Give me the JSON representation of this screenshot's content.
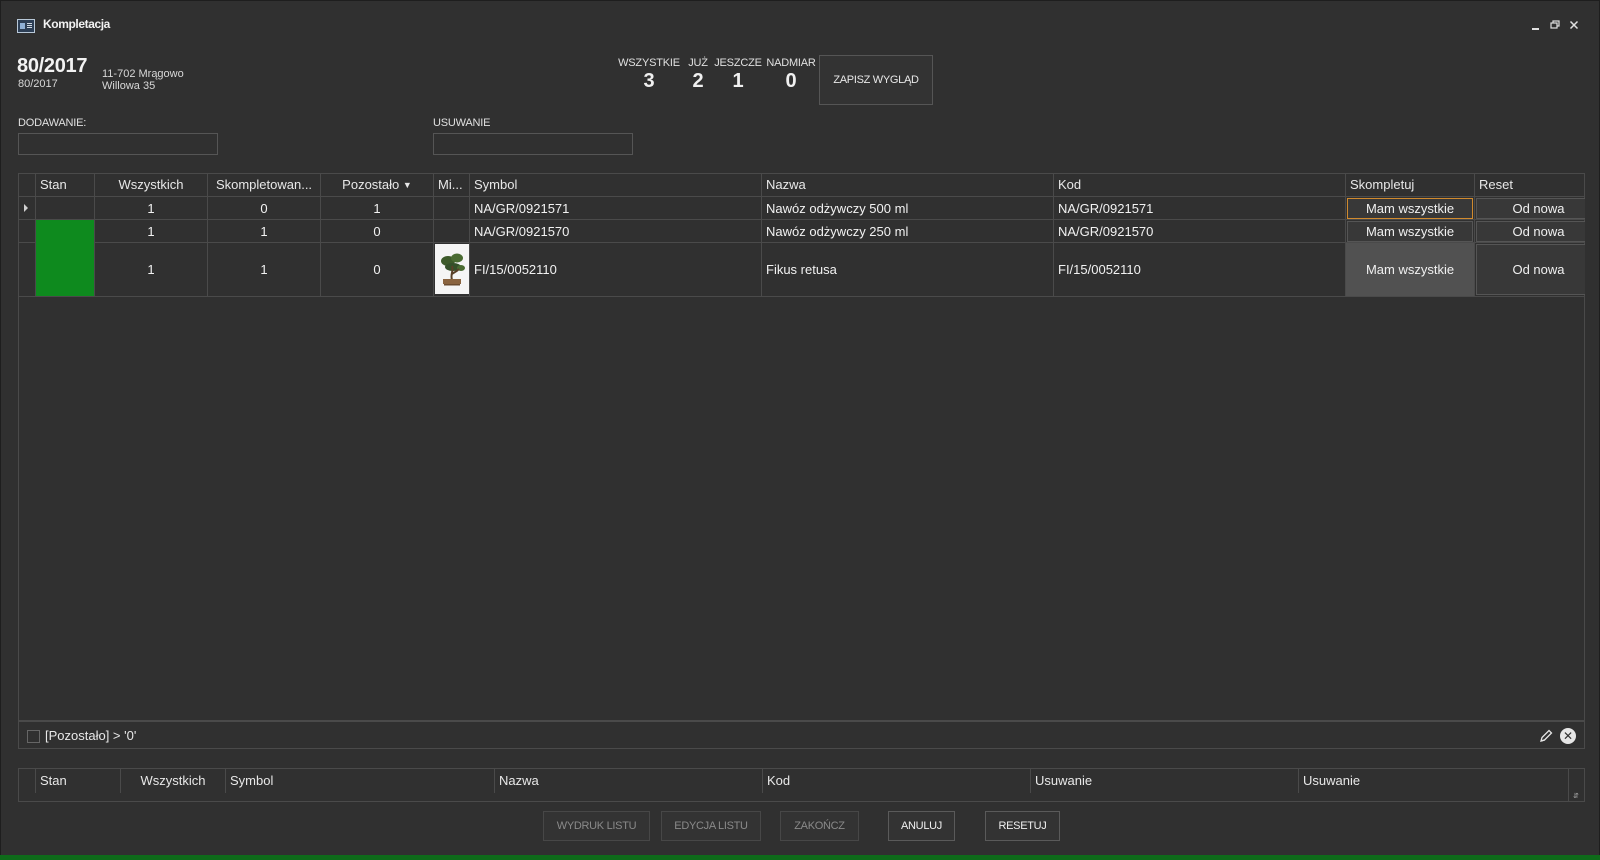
{
  "window": {
    "title": "Kompletacja",
    "minimize_icon": "minimize-icon",
    "restore_icon": "restore-icon",
    "close_icon": "close-icon"
  },
  "document": {
    "number": "80/2017",
    "sub_number": "80/2017",
    "address_line1": "11-702 Mrągowo",
    "address_line2": "Willowa 35"
  },
  "counters": [
    {
      "label": "WSZYSTKIE",
      "value": "3"
    },
    {
      "label": "JUŻ",
      "value": "2"
    },
    {
      "label": "JESZCZE",
      "value": "1"
    },
    {
      "label": "NADMIAR",
      "value": "0"
    }
  ],
  "save_layout_label": "ZAPISZ WYGLĄD",
  "fields": {
    "add_label": "DODAWANIE:",
    "add_value": "",
    "remove_label": "USUWANIE",
    "remove_value": ""
  },
  "grid": {
    "columns": [
      "Stan",
      "Wszystkich",
      "Skompletowan...",
      "Pozostało",
      "Mi...",
      "Symbol",
      "Nazwa",
      "Kod",
      "Skompletuj",
      "Reset"
    ],
    "filter_icon": "filter-icon",
    "rows": [
      {
        "stan_color": "",
        "wszystkich": "1",
        "skompletowane": "0",
        "pozostalo": "1",
        "has_image": false,
        "symbol": "NA/GR/0921571",
        "nazwa": "Nawóz odżywczy 500 ml",
        "kod": "NA/GR/0921571",
        "skompletuj": "Mam wszystkie",
        "reset": "Od nowa"
      },
      {
        "stan_color": "#0e8a1e",
        "wszystkich": "1",
        "skompletowane": "1",
        "pozostalo": "0",
        "has_image": false,
        "symbol": "NA/GR/0921570",
        "nazwa": "Nawóz odżywczy 250 ml",
        "kod": "NA/GR/0921570",
        "skompletuj": "Mam wszystkie",
        "reset": "Od nowa"
      },
      {
        "stan_color": "#0e8a1e",
        "wszystkich": "1",
        "skompletowane": "1",
        "pozostalo": "0",
        "has_image": true,
        "symbol": "FI/15/0052110",
        "nazwa": "Fikus retusa",
        "kod": "FI/15/0052110",
        "skompletuj": "Mam wszystkie",
        "reset": "Od nowa"
      }
    ]
  },
  "filter": {
    "text": "[Pozostało] > '0'",
    "checked": false
  },
  "grid2": {
    "columns": [
      "Stan",
      "Wszystkich",
      "Symbol",
      "Nazwa",
      "Kod",
      "Usuwanie",
      "Usuwanie"
    ]
  },
  "buttons": {
    "print": "WYDRUK LISTU",
    "edit": "EDYCJA LISTU",
    "finish": "ZAKOŃCZ",
    "cancel": "ANULUJ",
    "reset": "RESETUJ"
  }
}
